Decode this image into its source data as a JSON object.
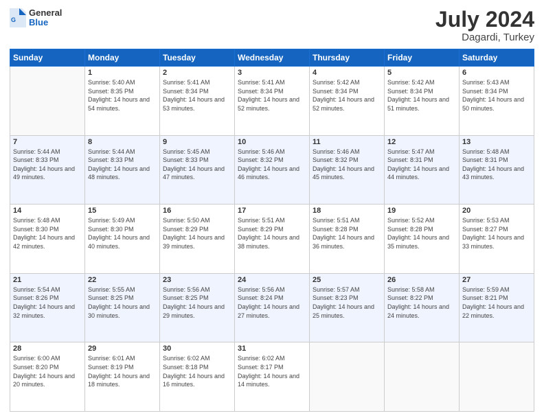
{
  "header": {
    "logo": {
      "general": "General",
      "blue": "Blue"
    },
    "title": "July 2024",
    "subtitle": "Dagardi, Turkey"
  },
  "calendar": {
    "days_of_week": [
      "Sunday",
      "Monday",
      "Tuesday",
      "Wednesday",
      "Thursday",
      "Friday",
      "Saturday"
    ],
    "weeks": [
      [
        {
          "day": "",
          "empty": true
        },
        {
          "day": "1",
          "sunrise": "5:40 AM",
          "sunset": "8:35 PM",
          "daylight": "14 hours and 54 minutes."
        },
        {
          "day": "2",
          "sunrise": "5:41 AM",
          "sunset": "8:34 PM",
          "daylight": "14 hours and 53 minutes."
        },
        {
          "day": "3",
          "sunrise": "5:41 AM",
          "sunset": "8:34 PM",
          "daylight": "14 hours and 52 minutes."
        },
        {
          "day": "4",
          "sunrise": "5:42 AM",
          "sunset": "8:34 PM",
          "daylight": "14 hours and 52 minutes."
        },
        {
          "day": "5",
          "sunrise": "5:42 AM",
          "sunset": "8:34 PM",
          "daylight": "14 hours and 51 minutes."
        },
        {
          "day": "6",
          "sunrise": "5:43 AM",
          "sunset": "8:34 PM",
          "daylight": "14 hours and 50 minutes."
        }
      ],
      [
        {
          "day": "7",
          "sunrise": "5:44 AM",
          "sunset": "8:33 PM",
          "daylight": "14 hours and 49 minutes."
        },
        {
          "day": "8",
          "sunrise": "5:44 AM",
          "sunset": "8:33 PM",
          "daylight": "14 hours and 48 minutes."
        },
        {
          "day": "9",
          "sunrise": "5:45 AM",
          "sunset": "8:33 PM",
          "daylight": "14 hours and 47 minutes."
        },
        {
          "day": "10",
          "sunrise": "5:46 AM",
          "sunset": "8:32 PM",
          "daylight": "14 hours and 46 minutes."
        },
        {
          "day": "11",
          "sunrise": "5:46 AM",
          "sunset": "8:32 PM",
          "daylight": "14 hours and 45 minutes."
        },
        {
          "day": "12",
          "sunrise": "5:47 AM",
          "sunset": "8:31 PM",
          "daylight": "14 hours and 44 minutes."
        },
        {
          "day": "13",
          "sunrise": "5:48 AM",
          "sunset": "8:31 PM",
          "daylight": "14 hours and 43 minutes."
        }
      ],
      [
        {
          "day": "14",
          "sunrise": "5:48 AM",
          "sunset": "8:30 PM",
          "daylight": "14 hours and 42 minutes."
        },
        {
          "day": "15",
          "sunrise": "5:49 AM",
          "sunset": "8:30 PM",
          "daylight": "14 hours and 40 minutes."
        },
        {
          "day": "16",
          "sunrise": "5:50 AM",
          "sunset": "8:29 PM",
          "daylight": "14 hours and 39 minutes."
        },
        {
          "day": "17",
          "sunrise": "5:51 AM",
          "sunset": "8:29 PM",
          "daylight": "14 hours and 38 minutes."
        },
        {
          "day": "18",
          "sunrise": "5:51 AM",
          "sunset": "8:28 PM",
          "daylight": "14 hours and 36 minutes."
        },
        {
          "day": "19",
          "sunrise": "5:52 AM",
          "sunset": "8:28 PM",
          "daylight": "14 hours and 35 minutes."
        },
        {
          "day": "20",
          "sunrise": "5:53 AM",
          "sunset": "8:27 PM",
          "daylight": "14 hours and 33 minutes."
        }
      ],
      [
        {
          "day": "21",
          "sunrise": "5:54 AM",
          "sunset": "8:26 PM",
          "daylight": "14 hours and 32 minutes."
        },
        {
          "day": "22",
          "sunrise": "5:55 AM",
          "sunset": "8:25 PM",
          "daylight": "14 hours and 30 minutes."
        },
        {
          "day": "23",
          "sunrise": "5:56 AM",
          "sunset": "8:25 PM",
          "daylight": "14 hours and 29 minutes."
        },
        {
          "day": "24",
          "sunrise": "5:56 AM",
          "sunset": "8:24 PM",
          "daylight": "14 hours and 27 minutes."
        },
        {
          "day": "25",
          "sunrise": "5:57 AM",
          "sunset": "8:23 PM",
          "daylight": "14 hours and 25 minutes."
        },
        {
          "day": "26",
          "sunrise": "5:58 AM",
          "sunset": "8:22 PM",
          "daylight": "14 hours and 24 minutes."
        },
        {
          "day": "27",
          "sunrise": "5:59 AM",
          "sunset": "8:21 PM",
          "daylight": "14 hours and 22 minutes."
        }
      ],
      [
        {
          "day": "28",
          "sunrise": "6:00 AM",
          "sunset": "8:20 PM",
          "daylight": "14 hours and 20 minutes."
        },
        {
          "day": "29",
          "sunrise": "6:01 AM",
          "sunset": "8:19 PM",
          "daylight": "14 hours and 18 minutes."
        },
        {
          "day": "30",
          "sunrise": "6:02 AM",
          "sunset": "8:18 PM",
          "daylight": "14 hours and 16 minutes."
        },
        {
          "day": "31",
          "sunrise": "6:02 AM",
          "sunset": "8:17 PM",
          "daylight": "14 hours and 14 minutes."
        },
        {
          "day": "",
          "empty": true
        },
        {
          "day": "",
          "empty": true
        },
        {
          "day": "",
          "empty": true
        }
      ]
    ]
  }
}
